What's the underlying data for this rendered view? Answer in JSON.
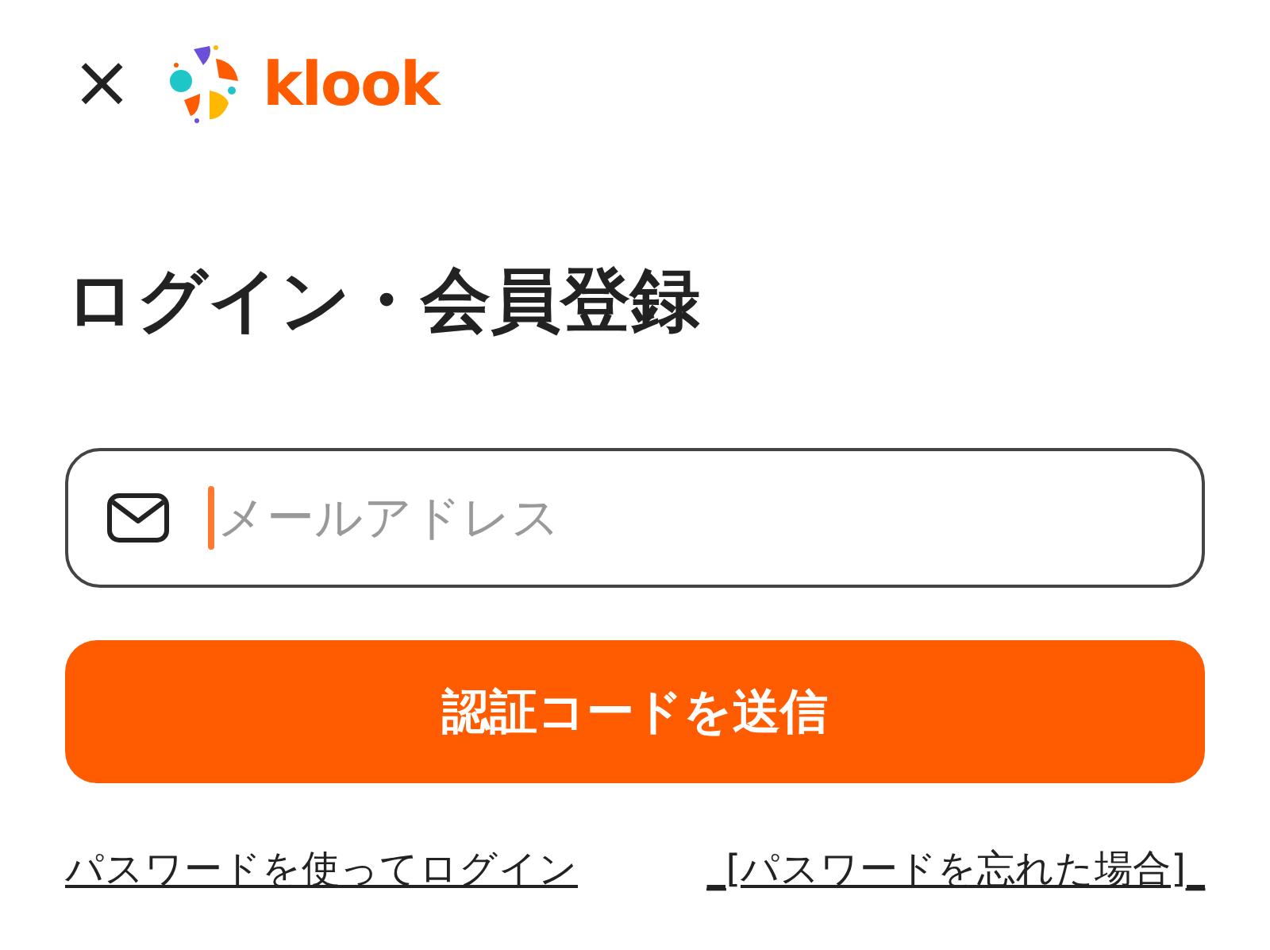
{
  "header": {
    "close": "×",
    "logo": "klook"
  },
  "title": "ログイン・会員登録",
  "email_field": {
    "placeholder": "メールアドレス"
  },
  "submit_button": "認証コードを送信",
  "links": [
    {
      "label": "パスワードを使ってログイン"
    },
    {
      "label": "_[パスワードを忘れた場合]_"
    }
  ]
}
